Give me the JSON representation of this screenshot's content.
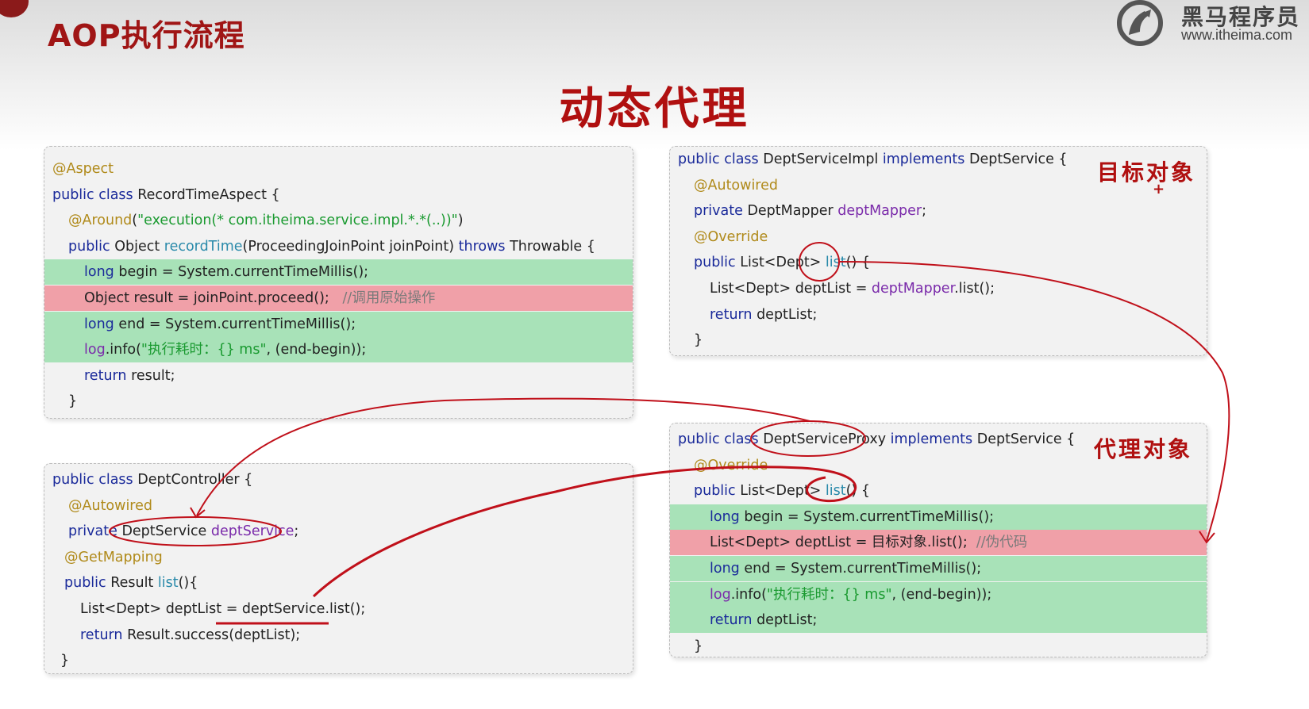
{
  "header": {
    "title": "AOP执行流程",
    "logo_text": "黑马程序员",
    "logo_url": "www.itheima.com",
    "logo_icon": "horse-logo-icon"
  },
  "slide_title": "动态代理",
  "aspect_panel": {
    "lines": [
      {
        "parts": [
          {
            "t": "@Aspect",
            "c": "an"
          }
        ]
      },
      {
        "parts": [
          {
            "t": "public class ",
            "c": "kw"
          },
          {
            "t": "RecordTimeAspect {",
            "c": ""
          }
        ]
      },
      {
        "parts": [
          {
            "t": "@Around",
            "c": "an"
          },
          {
            "t": "(",
            "c": ""
          },
          {
            "t": "\"execution(* com.itheima.service.impl.*.*(..))\"",
            "c": "st"
          },
          {
            "t": ")",
            "c": ""
          }
        ]
      },
      {
        "parts": [
          {
            "t": "public ",
            "c": "kw"
          },
          {
            "t": "Object ",
            "c": ""
          },
          {
            "t": "recordTime",
            "c": "fn"
          },
          {
            "t": "(ProceedingJoinPoint joinPoint) ",
            "c": ""
          },
          {
            "t": "throws ",
            "c": "kw"
          },
          {
            "t": "Throwable {",
            "c": ""
          }
        ]
      },
      {
        "parts": [
          {
            "t": "long ",
            "c": "kw"
          },
          {
            "t": "begin = System.",
            "c": ""
          },
          {
            "t": "currentTimeMillis",
            "c": ""
          },
          {
            "t": "();",
            "c": ""
          }
        ]
      },
      {
        "parts": [
          {
            "t": "Object result = joinPoint.proceed();   ",
            "c": ""
          },
          {
            "t": "//调用原始操作",
            "c": "cm"
          }
        ]
      },
      {
        "parts": [
          {
            "t": "long ",
            "c": "kw"
          },
          {
            "t": "end = System.",
            "c": ""
          },
          {
            "t": "currentTimeMillis",
            "c": ""
          },
          {
            "t": "();",
            "c": ""
          }
        ]
      },
      {
        "parts": [
          {
            "t": "log",
            "c": "fld"
          },
          {
            "t": ".info(",
            "c": ""
          },
          {
            "t": "\"执行耗时：{} ms\"",
            "c": "st"
          },
          {
            "t": ", (end-begin));",
            "c": ""
          }
        ]
      },
      {
        "parts": [
          {
            "t": "return ",
            "c": "kw"
          },
          {
            "t": "result;",
            "c": ""
          }
        ]
      },
      {
        "parts": [
          {
            "t": "}",
            "c": ""
          }
        ]
      }
    ]
  },
  "impl_panel": {
    "label": "目标对象",
    "plus": "+",
    "lines": [
      {
        "parts": [
          {
            "t": "public class ",
            "c": "kw"
          },
          {
            "t": "DeptServiceImpl ",
            "c": ""
          },
          {
            "t": "implements ",
            "c": "kw"
          },
          {
            "t": "DeptService {",
            "c": ""
          }
        ]
      },
      {
        "parts": [
          {
            "t": "@Autowired",
            "c": "an"
          }
        ]
      },
      {
        "parts": [
          {
            "t": "private ",
            "c": "kw"
          },
          {
            "t": "DeptMapper ",
            "c": ""
          },
          {
            "t": "deptMapper",
            "c": "fld"
          },
          {
            "t": ";",
            "c": ""
          }
        ]
      },
      {
        "parts": [
          {
            "t": "@Override",
            "c": "an"
          }
        ]
      },
      {
        "parts": [
          {
            "t": "public ",
            "c": "kw"
          },
          {
            "t": "List<Dept> ",
            "c": ""
          },
          {
            "t": "list",
            "c": "fn"
          },
          {
            "t": "() {",
            "c": ""
          }
        ]
      },
      {
        "parts": [
          {
            "t": "List<Dept> deptList = ",
            "c": ""
          },
          {
            "t": "deptMapper",
            "c": "fld"
          },
          {
            "t": ".list();",
            "c": ""
          }
        ]
      },
      {
        "parts": [
          {
            "t": "return ",
            "c": "kw"
          },
          {
            "t": "deptList;",
            "c": ""
          }
        ]
      },
      {
        "parts": [
          {
            "t": "}",
            "c": ""
          }
        ]
      }
    ]
  },
  "controller_panel": {
    "lines": [
      {
        "parts": [
          {
            "t": "public class ",
            "c": "kw"
          },
          {
            "t": "DeptController {",
            "c": ""
          }
        ]
      },
      {
        "parts": [
          {
            "t": "@Autowired",
            "c": "an"
          }
        ]
      },
      {
        "parts": [
          {
            "t": "private ",
            "c": "kw"
          },
          {
            "t": "DeptService ",
            "c": ""
          },
          {
            "t": "deptService",
            "c": "fld"
          },
          {
            "t": ";",
            "c": ""
          }
        ]
      },
      {
        "parts": [
          {
            "t": "@GetMapping",
            "c": "an"
          }
        ]
      },
      {
        "parts": [
          {
            "t": "public ",
            "c": "kw"
          },
          {
            "t": "Result ",
            "c": ""
          },
          {
            "t": "list",
            "c": "fn"
          },
          {
            "t": "(){",
            "c": ""
          }
        ]
      },
      {
        "parts": [
          {
            "t": "List<Dept> deptList = deptService.list();",
            "c": ""
          }
        ]
      },
      {
        "parts": [
          {
            "t": "return ",
            "c": "kw"
          },
          {
            "t": "Result.",
            "c": ""
          },
          {
            "t": "success",
            "c": ""
          },
          {
            "t": "(deptList);",
            "c": ""
          }
        ]
      },
      {
        "parts": [
          {
            "t": "}",
            "c": ""
          }
        ]
      }
    ]
  },
  "proxy_panel": {
    "label": "代理对象",
    "lines": [
      {
        "parts": [
          {
            "t": "public class ",
            "c": "kw"
          },
          {
            "t": "DeptServiceProxy ",
            "c": ""
          },
          {
            "t": "implements ",
            "c": "kw"
          },
          {
            "t": "DeptService {",
            "c": ""
          }
        ]
      },
      {
        "parts": [
          {
            "t": "@Override",
            "c": "an"
          }
        ]
      },
      {
        "parts": [
          {
            "t": "public ",
            "c": "kw"
          },
          {
            "t": "List<Dept> ",
            "c": ""
          },
          {
            "t": "list",
            "c": "fn"
          },
          {
            "t": "() {",
            "c": ""
          }
        ]
      },
      {
        "parts": [
          {
            "t": "long ",
            "c": "kw"
          },
          {
            "t": "begin = System.",
            "c": ""
          },
          {
            "t": "currentTimeMillis",
            "c": ""
          },
          {
            "t": "();",
            "c": ""
          }
        ]
      },
      {
        "parts": [
          {
            "t": "List<Dept> deptList = 目标对象.list();  ",
            "c": ""
          },
          {
            "t": "//伪代码",
            "c": "cm"
          }
        ]
      },
      {
        "parts": [
          {
            "t": "long ",
            "c": "kw"
          },
          {
            "t": "end = System.",
            "c": ""
          },
          {
            "t": "currentTimeMillis",
            "c": ""
          },
          {
            "t": "();",
            "c": ""
          }
        ]
      },
      {
        "parts": [
          {
            "t": "log",
            "c": "fld"
          },
          {
            "t": ".info(",
            "c": ""
          },
          {
            "t": "\"执行耗时：{} ms\"",
            "c": "st"
          },
          {
            "t": ", (end-begin));",
            "c": ""
          }
        ]
      },
      {
        "parts": [
          {
            "t": "return ",
            "c": "kw"
          },
          {
            "t": "deptList;",
            "c": ""
          }
        ]
      },
      {
        "parts": [
          {
            "t": "}",
            "c": ""
          }
        ]
      }
    ]
  }
}
